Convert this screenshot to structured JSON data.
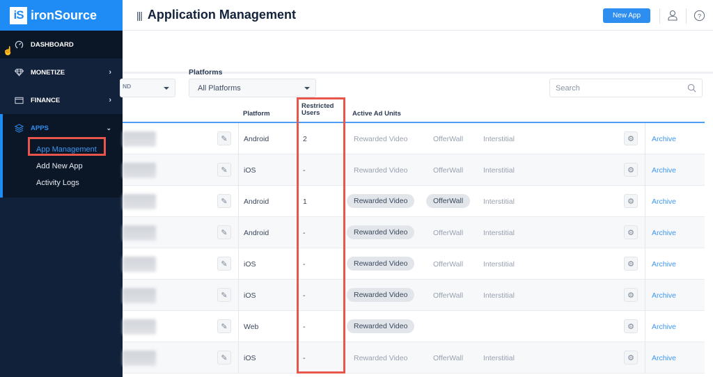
{
  "brand": {
    "mark": "iS",
    "name": "ironSource"
  },
  "sidebar": {
    "items": [
      {
        "label": "DASHBOARD",
        "icon": "gauge-icon"
      },
      {
        "label": "MONETIZE",
        "icon": "diamond-icon"
      },
      {
        "label": "FINANCE",
        "icon": "wallet-icon"
      },
      {
        "label": "APPS",
        "icon": "layers-icon"
      }
    ],
    "apps_sub": [
      {
        "label": "App Management",
        "active": true
      },
      {
        "label": "Add New App"
      },
      {
        "label": "Activity Logs"
      }
    ]
  },
  "header": {
    "title": "Application Management",
    "new_app_label": "New App"
  },
  "filters": {
    "platforms_label": "Platforms",
    "platforms_value": "All Platforms",
    "first_value": "",
    "search_placeholder": "Search"
  },
  "table": {
    "partial_label": "ND",
    "columns": {
      "platform": "Platform",
      "restricted": "Restricted Users",
      "active_units": "Active Ad Units"
    },
    "archive_label": "Archive",
    "rows": [
      {
        "platform": "Android",
        "restricted": "2",
        "units": [
          [
            "Rewarded Video",
            false
          ],
          [
            "OfferWall",
            false
          ],
          [
            "Interstitial",
            false
          ]
        ]
      },
      {
        "platform": "iOS",
        "restricted": "-",
        "units": [
          [
            "Rewarded Video",
            false
          ],
          [
            "OfferWall",
            false
          ],
          [
            "Interstitial",
            false
          ]
        ]
      },
      {
        "platform": "Android",
        "restricted": "1",
        "units": [
          [
            "Rewarded Video",
            true
          ],
          [
            "OfferWall",
            true
          ],
          [
            "Interstitial",
            false
          ]
        ]
      },
      {
        "platform": "Android",
        "restricted": "-",
        "units": [
          [
            "Rewarded Video",
            true
          ],
          [
            "OfferWall",
            false
          ],
          [
            "Interstitial",
            false
          ]
        ]
      },
      {
        "platform": "iOS",
        "restricted": "-",
        "units": [
          [
            "Rewarded Video",
            true
          ],
          [
            "OfferWall",
            false
          ],
          [
            "Interstitial",
            false
          ]
        ]
      },
      {
        "platform": "iOS",
        "restricted": "-",
        "units": [
          [
            "Rewarded Video",
            true
          ],
          [
            "OfferWall",
            false
          ],
          [
            "Interstitial",
            false
          ]
        ]
      },
      {
        "platform": "Web",
        "restricted": "-",
        "units": [
          [
            "Rewarded Video",
            true
          ]
        ]
      },
      {
        "platform": "iOS",
        "restricted": "-",
        "units": [
          [
            "Rewarded Video",
            false
          ],
          [
            "OfferWall",
            false
          ],
          [
            "Interstitial",
            false
          ]
        ]
      }
    ]
  },
  "colors": {
    "brand": "#1f8bf5",
    "sidebar": "#112139",
    "highlight": "#e8554a",
    "link": "#3c97f3"
  }
}
